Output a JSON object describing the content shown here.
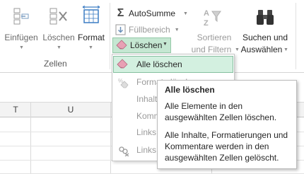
{
  "ribbon": {
    "cells_group": {
      "label": "Zellen",
      "insert_label": "Einfügen",
      "delete_label": "Löschen",
      "format_label": "Format"
    },
    "editing": {
      "autosum_label": "AutoSumme",
      "fill_label": "Füllbereich",
      "clear_label": "Löschen",
      "sort_line1": "Sortieren",
      "sort_line2": "und Filtern",
      "find_line1": "Suchen und",
      "find_line2": "Auswählen"
    }
  },
  "sheet": {
    "columns": [
      "T",
      "U"
    ]
  },
  "clear_menu": {
    "items": [
      {
        "label": "Alle löschen",
        "icon": "eraser-icon",
        "highlighted": true
      },
      {
        "label": "Formate löschen",
        "icon": "eraser-format-icon"
      },
      {
        "label": "Inhalte löschen"
      },
      {
        "label": "Kommentare löschen"
      },
      {
        "label": "Links löschen"
      },
      {
        "label": "Links entfernen",
        "icon": "hyperlink-remove-icon"
      }
    ]
  },
  "tooltip": {
    "title": "Alle löschen",
    "paragraph1": "Alle Elemente in den ausgewählten Zellen löschen.",
    "paragraph2": "Alle Inhalte, Formatierungen und Kommentare werden in den ausgewählten Zellen gelöscht."
  },
  "colors": {
    "accent_green": "#217346",
    "highlight": "#d3f0e0",
    "highlight_border": "#86bfa0"
  }
}
